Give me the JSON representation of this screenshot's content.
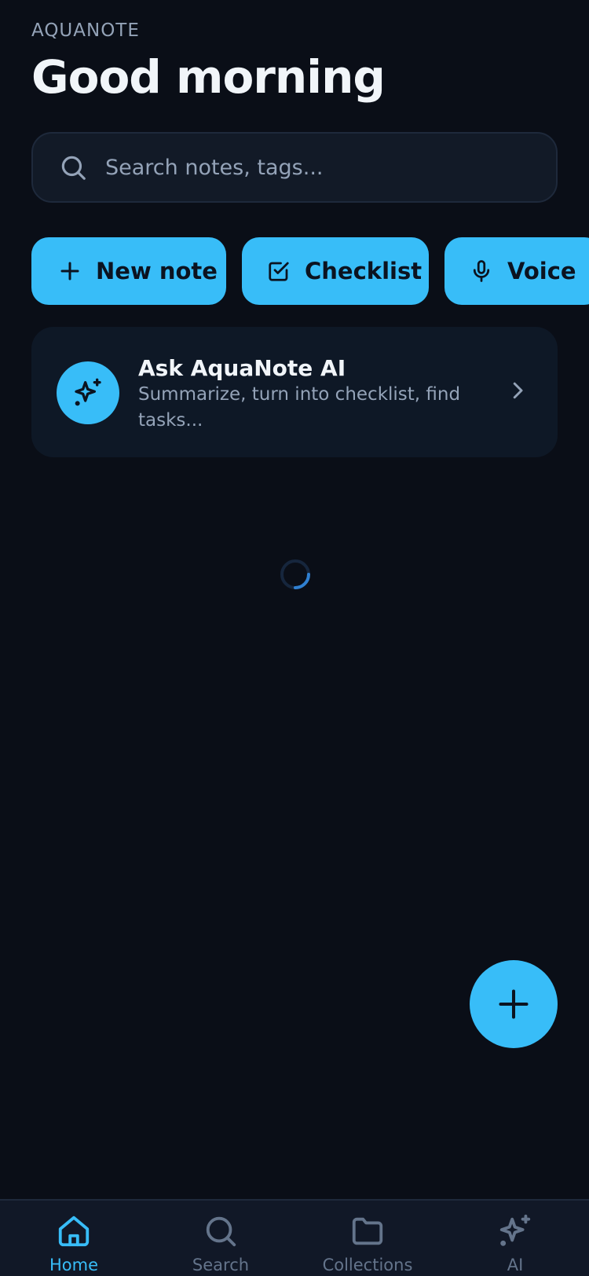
{
  "header": {
    "app_name": "AQUANOTE",
    "greeting": "Good morning"
  },
  "search": {
    "placeholder": "Search notes, tags..."
  },
  "quick_actions": [
    {
      "label": "New note",
      "icon": "plus-icon"
    },
    {
      "label": "Checklist",
      "icon": "checkbox-icon"
    },
    {
      "label": "Voice",
      "icon": "microphone-icon"
    }
  ],
  "ai_card": {
    "title": "Ask AquaNote AI",
    "subtitle": "Summarize, turn into checklist, find tasks...",
    "icon": "sparkles-icon"
  },
  "loading": true,
  "fab": {
    "icon": "plus-icon"
  },
  "bottom_nav": [
    {
      "label": "Home",
      "icon": "home-icon",
      "active": true
    },
    {
      "label": "Search",
      "icon": "search-icon",
      "active": false
    },
    {
      "label": "Collections",
      "icon": "folder-icon",
      "active": false
    },
    {
      "label": "AI",
      "icon": "sparkles-icon",
      "active": false
    }
  ],
  "colors": {
    "background": "#0a0e17",
    "accent": "#38bdf8",
    "card": "#0e1826",
    "muted_text": "#94a3b8"
  }
}
